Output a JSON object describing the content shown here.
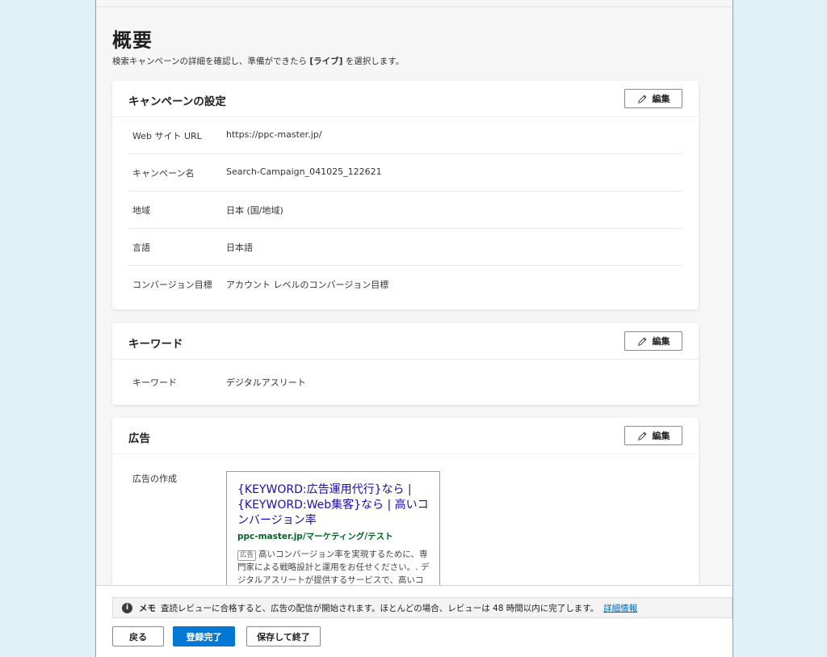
{
  "page": {
    "title": "概要",
    "subtitle_before": "検索キャンペーンの詳細を確認し、準備ができたら ",
    "subtitle_bold": "[ライブ]",
    "subtitle_after": " を選択します。"
  },
  "edit_label": "編集",
  "campaign_settings": {
    "title": "キャンペーンの設定",
    "rows": [
      {
        "label": "Web サイト URL",
        "value": "https://ppc-master.jp/"
      },
      {
        "label": "キャンペーン名",
        "value": "Search-Campaign_041025_122621"
      },
      {
        "label": "地域",
        "value": "日本 (国/地域)"
      },
      {
        "label": "言語",
        "value": "日本語"
      },
      {
        "label": "コンバージョン目標",
        "value": "アカウント レベルのコンバージョン目標"
      }
    ]
  },
  "keywords": {
    "title": "キーワード",
    "rows": [
      {
        "label": "キーワード",
        "value": "デジタルアスリート"
      }
    ]
  },
  "ads": {
    "title": "広告",
    "create_label": "広告の作成",
    "preview": {
      "headline": "{KEYWORD:広告運用代行}なら | {KEYWORD:Web集客}なら | 高いコンバージョン率",
      "url": "ppc-master.jp/マーケティング/テスト",
      "badge": "広告",
      "description": "高いコンバージョン率を実現するために、専門家による戦略設計と運用をお任せください。. デジタルアスリートが提供するサービスで、高いコンバージョン率を目指しましょう。"
    }
  },
  "notice": {
    "icon": "info-icon",
    "label": "メモ",
    "text": "査読レビューに合格すると、広告の配信が開始されます。ほとんどの場合、レビューは 48 時間以内に完了します。",
    "link": "詳細情報"
  },
  "footer": {
    "back_label": "戻る",
    "finish_label": "登録完了",
    "save_exit_label": "保存して終了"
  },
  "colors": {
    "primary": "#0078d4",
    "headline_link": "#1a0dab",
    "ad_url": "#006621",
    "page_bg": "#dff0f7"
  }
}
